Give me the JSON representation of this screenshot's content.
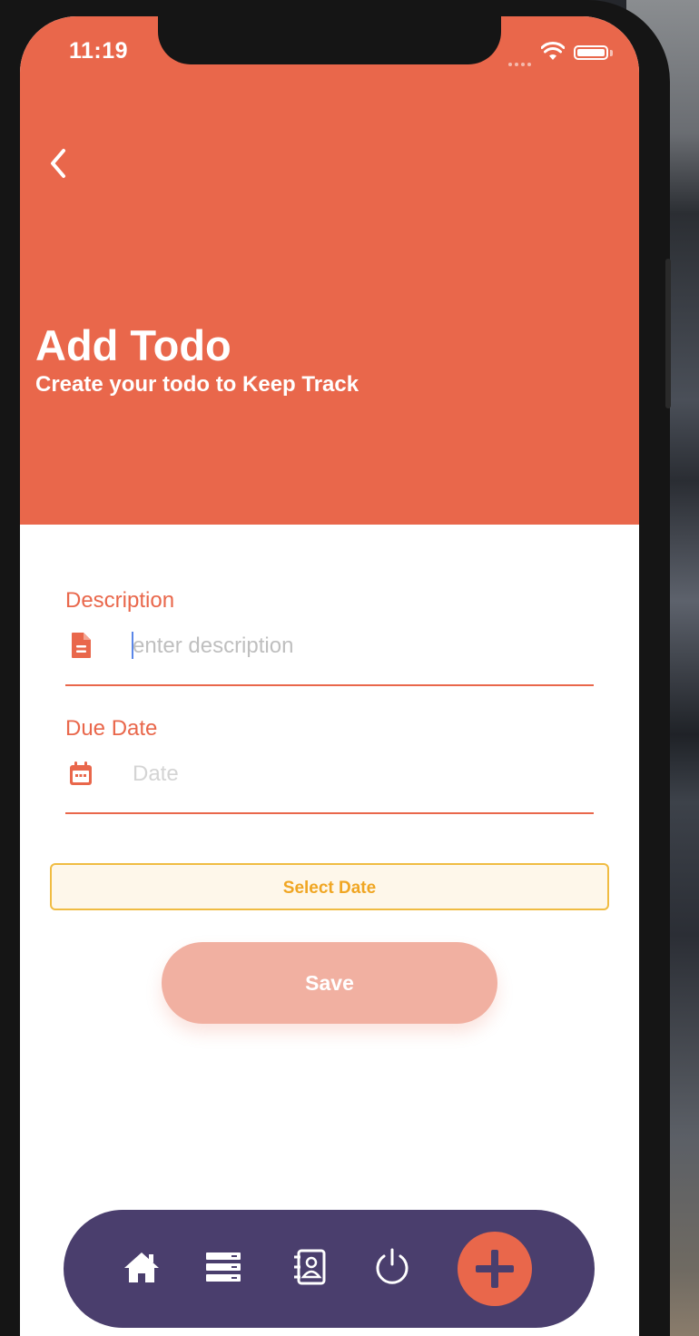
{
  "status_bar": {
    "time": "11:19"
  },
  "header": {
    "title": "Add Todo",
    "subtitle": "Create your todo to Keep Track",
    "back_icon": "chevron-left-icon"
  },
  "form": {
    "description": {
      "label": "Description",
      "placeholder": "enter description",
      "value": "",
      "icon": "document-icon"
    },
    "due_date": {
      "label": "Due Date",
      "placeholder": "Date",
      "value": "",
      "icon": "calendar-icon"
    },
    "select_date_label": "Select Date",
    "save_label": "Save"
  },
  "bottom_nav": {
    "items": [
      {
        "icon": "home-icon"
      },
      {
        "icon": "list-icon"
      },
      {
        "icon": "contacts-icon"
      },
      {
        "icon": "power-icon"
      },
      {
        "icon": "add-icon"
      }
    ]
  },
  "colors": {
    "accent": "#e9674b",
    "nav_background": "#4a3e6d",
    "select_date_text": "#f0a623",
    "select_date_border": "#f0bc42",
    "save_button": "#f1b0a1"
  }
}
